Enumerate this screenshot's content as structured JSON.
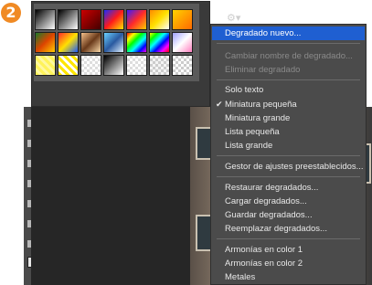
{
  "step_number": "2",
  "menu": {
    "items": [
      {
        "label": "Degradado nuevo...",
        "state": "highlighted"
      },
      {
        "label": "Cambiar nombre de degradado...",
        "state": "disabled"
      },
      {
        "label": "Eliminar degradado",
        "state": "disabled"
      },
      {
        "label": "Solo texto",
        "state": "normal"
      },
      {
        "label": "Miniatura pequeña",
        "state": "checked"
      },
      {
        "label": "Miniatura grande",
        "state": "normal"
      },
      {
        "label": "Lista pequeña",
        "state": "normal"
      },
      {
        "label": "Lista grande",
        "state": "normal"
      },
      {
        "label": "Gestor de ajustes preestablecidos...",
        "state": "normal"
      },
      {
        "label": "Restaurar degradados...",
        "state": "normal"
      },
      {
        "label": "Cargar degradados...",
        "state": "normal"
      },
      {
        "label": "Guardar degradados...",
        "state": "normal"
      },
      {
        "label": "Reemplazar degradados...",
        "state": "normal"
      },
      {
        "label": "Armonías en color 1",
        "state": "normal"
      },
      {
        "label": "Armonías en color 2",
        "state": "normal"
      },
      {
        "label": "Metales",
        "state": "normal"
      }
    ],
    "checkmark": "✔"
  },
  "gear_icon": "gear-icon",
  "colors": {
    "menu_bg": "#4b4b4b",
    "highlight": "#1f5fd1",
    "badge": "#f08a24",
    "panel_bg": "#3a3a3a"
  }
}
